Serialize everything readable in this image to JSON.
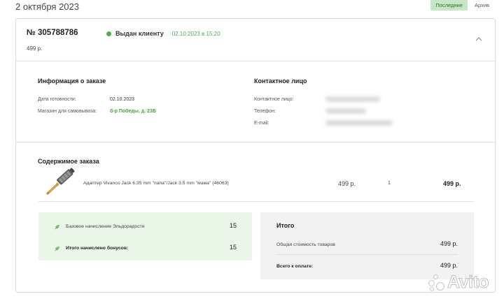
{
  "date_heading": "2 октября 2023",
  "filters": {
    "latest": "Последние",
    "archive": "Архив"
  },
  "order": {
    "number": "№ 305788786",
    "status": "Выдан клиенту",
    "status_date": "02.10.2023 в 15:20",
    "price": "499 р."
  },
  "order_info": {
    "title": "Информация о заказе",
    "ready_label": "Дата готовности:",
    "ready_value": "02.10.2023",
    "store_label": "Магазин для самовывоза:",
    "store_value": "б-р Победы, д. 23Б"
  },
  "contact": {
    "title": "Контактное лицо",
    "person_label": "Контактное лицо:",
    "phone_label": "Телефон:",
    "email_label": "E-mail:"
  },
  "contents": {
    "title": "Содержимое заказа",
    "product_name": "Адаптер Vivanco Jack 6.35 mm \"папа\"/Jack 3.5 mm \"мама\" (46063)",
    "price": "499 р.",
    "qty": "1",
    "total": "499 р."
  },
  "bonuses": {
    "base_label": "Базовое начисление Эльдорадости",
    "base_value": "15",
    "total_label": "Итого начислено бонусов:",
    "total_value": "15"
  },
  "summary": {
    "title": "Итого",
    "goods_label": "Общая стоимость товаров",
    "goods_value": "499 р.",
    "pay_label": "Всего к оплате:",
    "pay_value": "499 р."
  },
  "watermark": "Avito",
  "colors": {
    "accent_green": "#4caf50",
    "bonus_bg": "#eaf6e8",
    "filter_active_bg": "#c5e7c3"
  }
}
